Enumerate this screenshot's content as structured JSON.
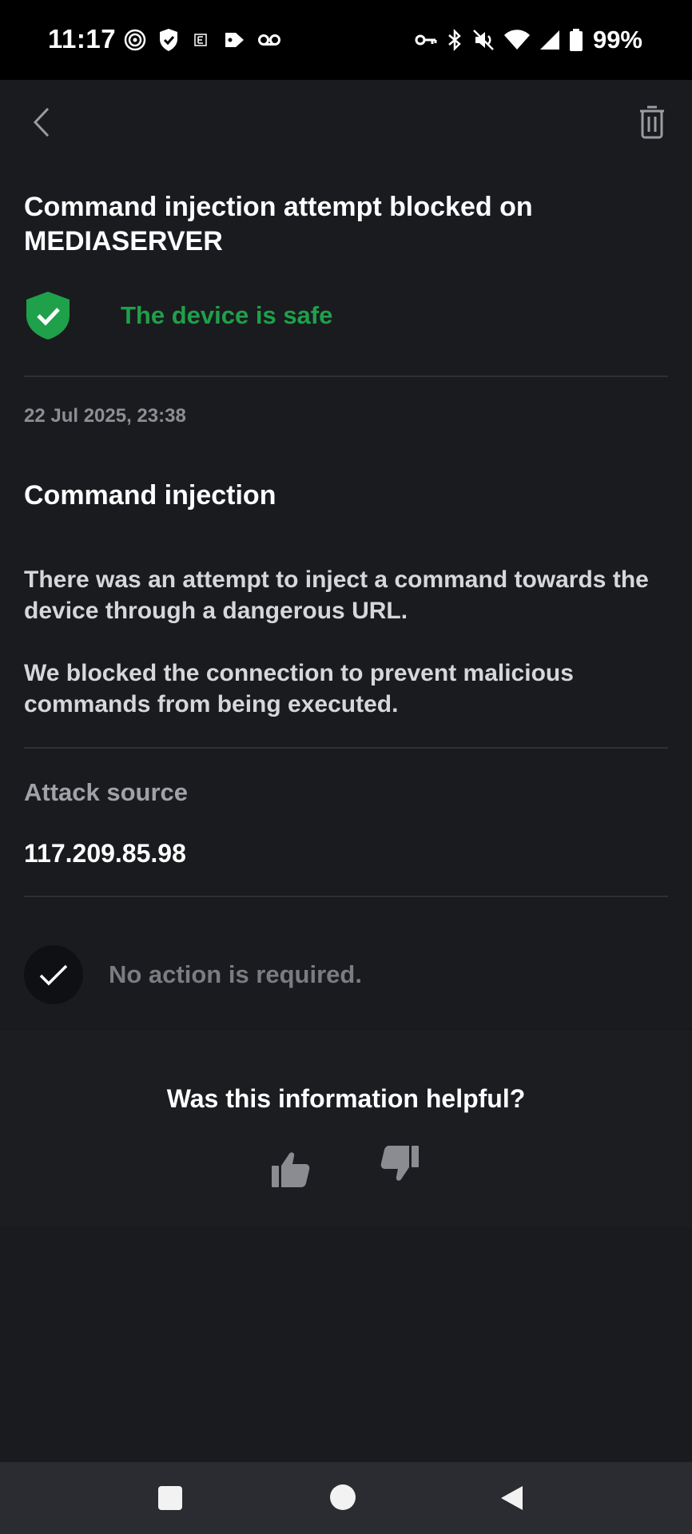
{
  "status_bar": {
    "time": "11:17",
    "battery_percent": "99%",
    "left_icons": [
      "hotspot-icon",
      "shield-check-icon",
      "app-notification-icon",
      "tag-icon",
      "voicemail-icon"
    ],
    "right_icons": [
      "vpn-key-icon",
      "bluetooth-icon",
      "mute-icon",
      "wifi-icon",
      "cell-signal-icon",
      "battery-icon"
    ]
  },
  "header": {
    "back_icon": "chevron-left-icon",
    "delete_icon": "trash-icon"
  },
  "alert": {
    "title": "Command injection attempt blocked on MEDIASERVER",
    "status_text": "The device is safe",
    "status_color": "#1fa04a",
    "timestamp": "22 Jul 2025, 23:38",
    "section_title": "Command injection",
    "description_1": "There was an attempt to inject a command towards the device through a dangerous URL.",
    "description_2": "We blocked the connection to prevent malicious commands from being executed.",
    "attack_source_label": "Attack source",
    "attack_source_value": "117.209.85.98",
    "action_text": "No action is required."
  },
  "feedback": {
    "question": "Was this information helpful?"
  },
  "nav_bar": {
    "buttons": [
      "recents",
      "home",
      "back"
    ]
  }
}
